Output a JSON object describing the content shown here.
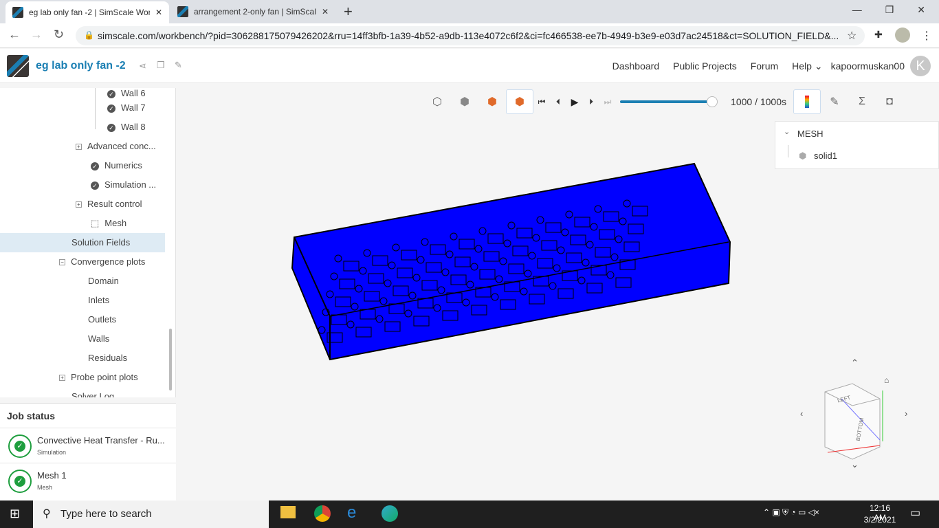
{
  "browser": {
    "tabs": [
      {
        "title": "eg lab only fan -2 | SimScale Wor"
      },
      {
        "title": "arrangement 2-only fan | SimScal"
      }
    ],
    "url": "simscale.com/workbench/?pid=3062881750794262​02&rru=14ff3bfb-1a39-4b52-a9db-113e4072c6f2&ci=fc466538-ee7b-4949-b3e9-e03d7ac24518&ct=SOLUTION_FIELD&..."
  },
  "app": {
    "project_title": "eg lab only fan -2",
    "nav": [
      "Dashboard",
      "Public Projects",
      "Forum",
      "Help"
    ],
    "user": "kapoormuskan00",
    "avatar_letter": "K"
  },
  "tree": {
    "items": [
      {
        "label": "Wall 6"
      },
      {
        "label": "Wall 7"
      },
      {
        "label": "Wall 8"
      },
      {
        "label": "Advanced conc..."
      },
      {
        "label": "Numerics"
      },
      {
        "label": "Simulation ..."
      },
      {
        "label": "Result control"
      },
      {
        "label": "Mesh"
      },
      {
        "label": "Solution Fields"
      },
      {
        "label": "Convergence plots"
      },
      {
        "label": "Domain"
      },
      {
        "label": "Inlets"
      },
      {
        "label": "Outlets"
      },
      {
        "label": "Walls"
      },
      {
        "label": "Residuals"
      },
      {
        "label": "Probe point plots"
      },
      {
        "label": "Solver Log"
      }
    ]
  },
  "job_status": {
    "title": "Job status",
    "jobs": [
      {
        "name": "Convective Heat Transfer - Ru...",
        "type": "Simulation"
      },
      {
        "name": "Mesh 1",
        "type": "Mesh"
      }
    ]
  },
  "viewer": {
    "time": "1000 / 1000s",
    "progress": 1.0,
    "mesh_header": "MESH",
    "mesh_item": "solid1",
    "cube_labels": [
      "LEFT",
      "BOTTOM"
    ],
    "model_color": "#0000ff"
  },
  "taskbar": {
    "search_placeholder": "Type here to search",
    "time": "12:16 AM",
    "date": "3/2/2021"
  }
}
